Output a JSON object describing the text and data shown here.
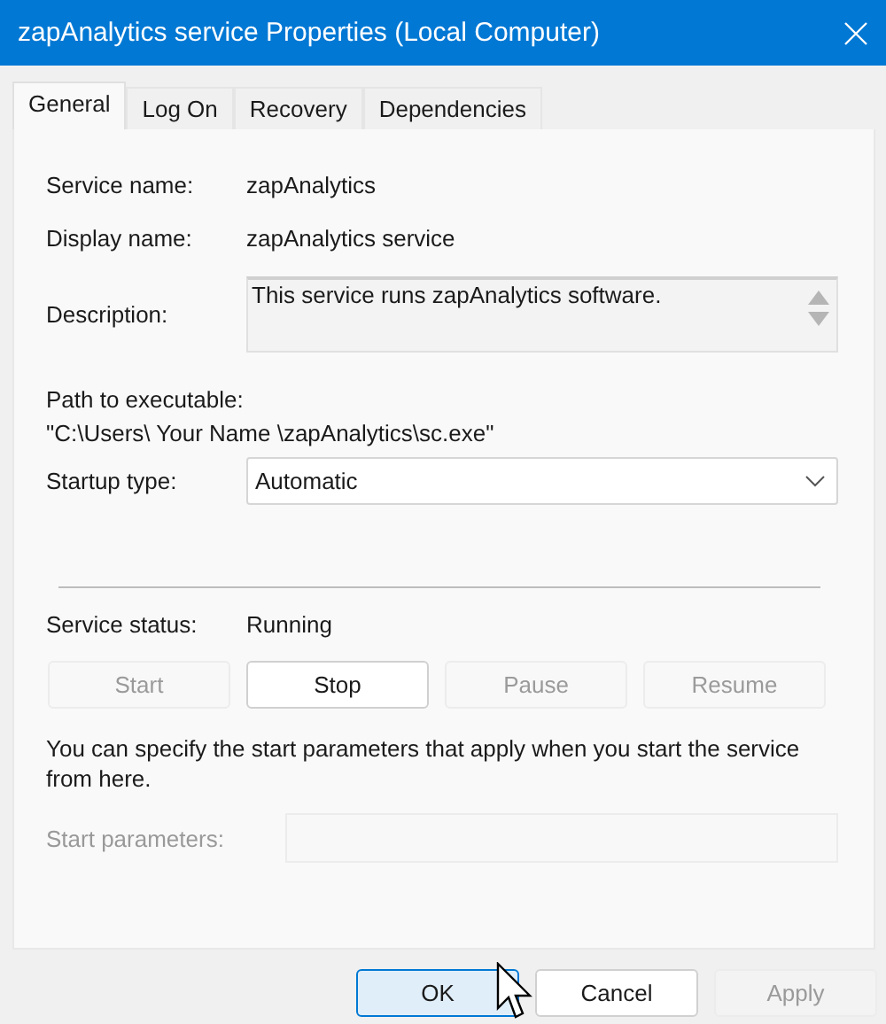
{
  "window": {
    "title": "zapAnalytics service Properties (Local Computer)"
  },
  "tabs": [
    {
      "label": "General",
      "selected": true
    },
    {
      "label": "Log On",
      "selected": false
    },
    {
      "label": "Recovery",
      "selected": false
    },
    {
      "label": "Dependencies",
      "selected": false
    }
  ],
  "fields": [
    {
      "label": "Service name:",
      "value": "zapAnalytics"
    },
    {
      "label": "Display name:",
      "value": "zapAnalytics service"
    }
  ],
  "description": {
    "label": "Description:",
    "value": "This service runs zapAnalytics software."
  },
  "path": {
    "label": "Path to executable:",
    "value": "\"C:\\Users\\  Your Name \\zapAnalytics\\sc.exe\""
  },
  "startup": {
    "label": "Startup type:",
    "value": "Automatic"
  },
  "status": {
    "label": "Service status:",
    "value": "Running"
  },
  "service_buttons": [
    {
      "label": "Start",
      "disabled": true
    },
    {
      "label": "Stop",
      "disabled": false
    },
    {
      "label": "Pause",
      "disabled": true
    },
    {
      "label": "Resume",
      "disabled": true
    }
  ],
  "hint": "You can specify the start parameters that apply when you start the service from here.",
  "start_parameters": {
    "label": "Start parameters:",
    "disabled": true
  },
  "buttons": [
    {
      "label": "OK",
      "default": true,
      "disabled": false
    },
    {
      "label": "Cancel",
      "default": false,
      "disabled": false
    },
    {
      "label": "Apply",
      "default": false,
      "disabled": true
    }
  ]
}
